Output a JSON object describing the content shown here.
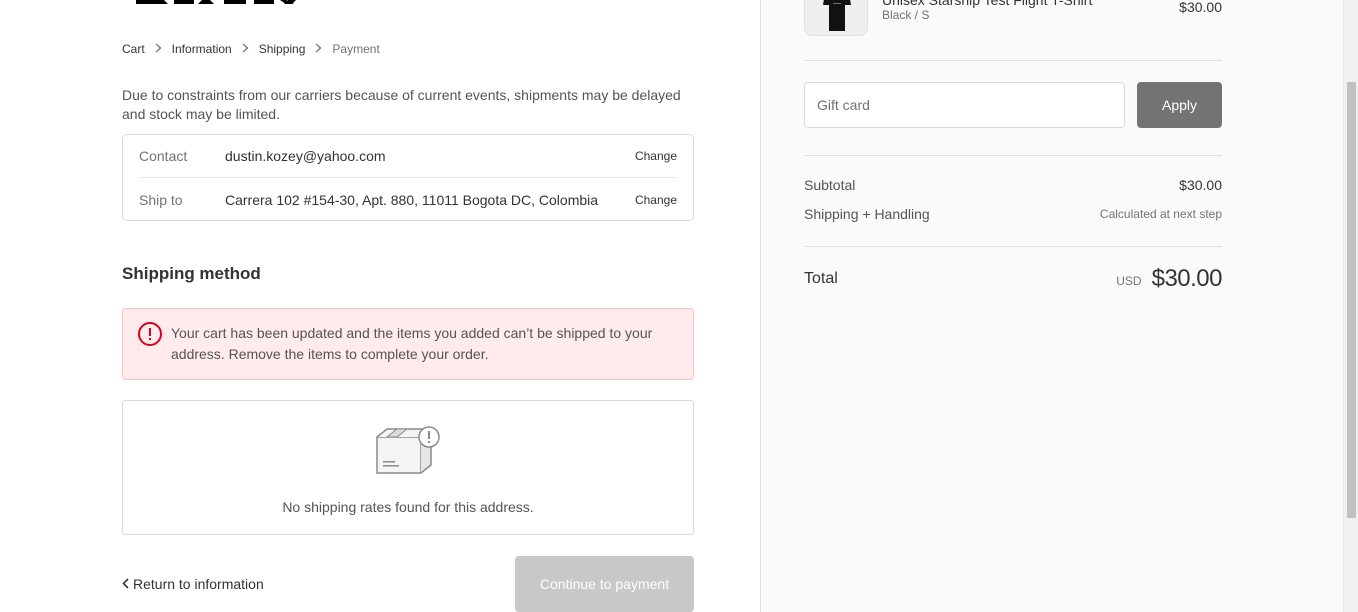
{
  "brand": "SPACEX",
  "breadcrumb": [
    {
      "label": "Cart"
    },
    {
      "label": "Information"
    },
    {
      "label": "Shipping"
    },
    {
      "label": "Payment"
    }
  ],
  "notice": "Due to constraints from our carriers because of current events, shipments may be delayed and stock may be limited.",
  "review": {
    "contact_label": "Contact",
    "contact_value": "dustin.kozey@yahoo.com",
    "ship_label": "Ship to",
    "ship_value": "Carrera 102 #154-30, Apt. 880, 11011 Bogota DC, Colombia",
    "change_label": "Change"
  },
  "shipping_method": {
    "title": "Shipping method",
    "error": "Your cart has been updated and the items you added can’t be shipped to your address. Remove the items to complete your order.",
    "no_rates": "No shipping rates found for this address."
  },
  "nav": {
    "return_label": "Return to information",
    "continue_label": "Continue to payment"
  },
  "product": {
    "name": "Unisex Starship Test Flight T-Shirt",
    "variant": "Black / S",
    "price": "$30.00"
  },
  "gift_card": {
    "placeholder": "Gift card",
    "apply_label": "Apply"
  },
  "summary": {
    "subtotal_label": "Subtotal",
    "subtotal_value": "$30.00",
    "shipping_label": "Shipping + Handling",
    "shipping_value": "Calculated at next step",
    "total_label": "Total",
    "currency": "USD",
    "total_value": "$30.00"
  },
  "colors": {
    "error_bg": "#ffebeb",
    "error_icon": "#d9001b",
    "button_disabled": "#c8c8c8",
    "apply_button": "#737373"
  }
}
